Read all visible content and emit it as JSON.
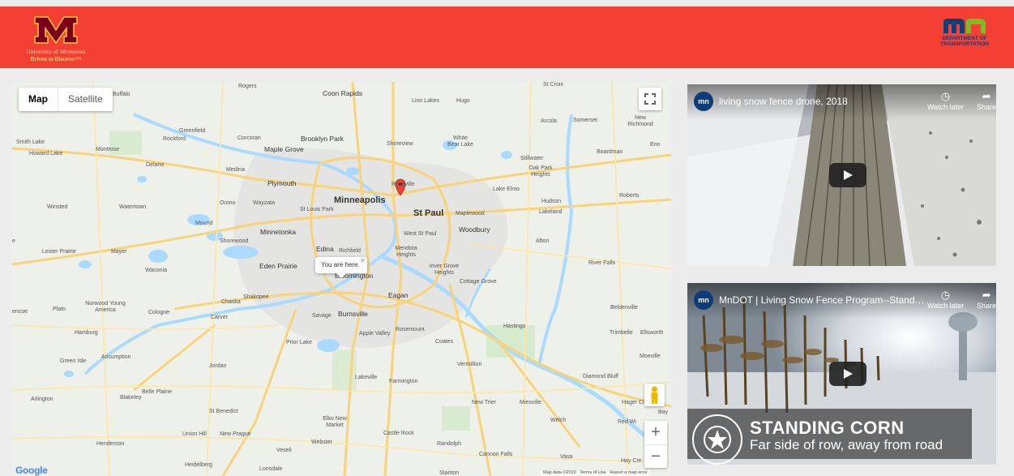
{
  "header": {
    "umn": {
      "name": "University of Minnesota",
      "tagline": "Driven to Discover™"
    },
    "mndot": {
      "letters": "mn",
      "name_line1": "DEPARTMENT OF",
      "name_line2": "TRANSPORTATION"
    },
    "colors": {
      "bar": "#f43f34",
      "umn_maroon": "#7a0019",
      "umn_gold": "#ffcc33",
      "mndot_blue": "#0d3f7a",
      "mndot_green": "#78be20"
    }
  },
  "map": {
    "type_control": {
      "map": "Map",
      "satellite": "Satellite",
      "selected": "Map"
    },
    "popup": {
      "text": "You are here.",
      "close": "×"
    },
    "zoom_in": "+",
    "zoom_out": "−",
    "google_logo": "Google",
    "attribution": {
      "data": "Map data ©2019",
      "terms": "Terms of Use",
      "report": "Report a map error"
    },
    "labels": {
      "rogers": "Rogers",
      "coon_rapids": "Coon Rapids",
      "lino_lakes": "Lino Lakes",
      "hugo": "Hugo",
      "st_croix": "St Croix",
      "buffalo": "Buffalo",
      "arcola": "Arcola",
      "somerset": "Somerset",
      "new_richmond": "New Richmond",
      "greenfield": "Greenfield",
      "rockford": "Rockford",
      "corcoran": "Corcoran",
      "brooklyn_park": "Brooklyn Park",
      "maple_grove": "Maple Grove",
      "shoreview": "Shoreview",
      "white_bear_lake": "White Bear Lake",
      "smith_lake": "Smith Lake",
      "howard_lake": "Howard Lake",
      "montrose": "Montrose",
      "delano": "Delano",
      "medina": "Medina",
      "stillwater": "Stillwater",
      "oak_park_heights": "Oak Park Heights",
      "boardman": "Boardman",
      "plymouth": "Plymouth",
      "roseville": "Roseville",
      "lake_elmo": "Lake Elmo",
      "hudson": "Hudson",
      "roberts": "Roberts",
      "winsted": "Winsted",
      "watertown": "Watertown",
      "orono": "Orono",
      "wayzata": "Wayzata",
      "st_louis_park": "St Louis Park",
      "minneapolis": "Minneapolis",
      "st_paul": "St Paul",
      "maplewood": "Maplewood",
      "lakeland": "Lakeland",
      "mound": "Mound",
      "west_st_paul": "West St Paul",
      "woodbury": "Woodbury",
      "minnetonka": "Minnetonka",
      "shorewood": "Shorewood",
      "lester_prairie": "Lester Prairie",
      "mayer": "Mayer",
      "edina": "Edina",
      "richfield": "Richfield",
      "mendota_heights": "Mendota Heights",
      "afton": "Afton",
      "waconia": "Waconia",
      "eden_prairie": "Eden Prairie",
      "bloomington": "Bloomington",
      "inver_grove_heights": "Inver Grove Heights",
      "river_falls": "River Falls",
      "cottage_grove": "Cottage Grove",
      "eagan": "Eagan",
      "chaska": "Chaska",
      "shakopee": "Shakopee",
      "norwood_young_america": "Norwood Young America",
      "plato": "Plato",
      "cologne": "Cologne",
      "carver": "Carver",
      "savage": "Savage",
      "burnsville": "Burnsville",
      "ellsworth": "Ellsworth",
      "beldenville": "Beldenville",
      "hastings": "Hastings",
      "trimbelle": "Trimbelle",
      "hamburg": "Hamburg",
      "apple_valley": "Apple Valley",
      "rosemount": "Rosemount",
      "prior_lake": "Prior Lake",
      "coates": "Coates",
      "assumption": "Assumption",
      "green_isle": "Green Isle",
      "jordan": "Jordan",
      "vermillion": "Vermillion",
      "moeville": "Moeville",
      "lakeville": "Lakeville",
      "farmington": "Farmington",
      "diamond_bluff": "Diamond Bluff",
      "belle_plaine": "Belle Plaine",
      "arlington": "Arlington",
      "blakeley": "Blakeley",
      "new_trier": "New Trier",
      "miesville": "Miesville",
      "hager_city": "Hager City",
      "st_benedict": "St Benedict",
      "elko_new_market": "Elko New Market",
      "welch": "Welch",
      "red_wing": "Red Wi",
      "castle_rock": "Castle Rock",
      "union_hill": "Union Hill",
      "new_prague": "New Prague",
      "henderson": "Henderson",
      "webster": "Webster",
      "randolph": "Randolph",
      "cannon_falls": "Cannon Falls",
      "veseli": "Veseli",
      "vasa": "Vasa",
      "hay_creek": "Hay Cre",
      "heidelberg": "Heidelberg",
      "lonsdale": "Lonsdale",
      "stanton": "Stanton",
      "encoe": "encoe",
      "e": "e",
      "enn": "Enn",
      "bay": "Bay"
    }
  },
  "videos": [
    {
      "channel": "mn",
      "title": "living snow fence drone, 2018",
      "watch_later": "Watch later",
      "share": "Share"
    },
    {
      "channel": "mn",
      "title": "MnDOT | Living Snow Fence Program--Standing…",
      "watch_later": "Watch later",
      "share": "Share",
      "overlay_title": "STANDING CORN",
      "overlay_subtitle": "Far side of row, away from road"
    }
  ]
}
